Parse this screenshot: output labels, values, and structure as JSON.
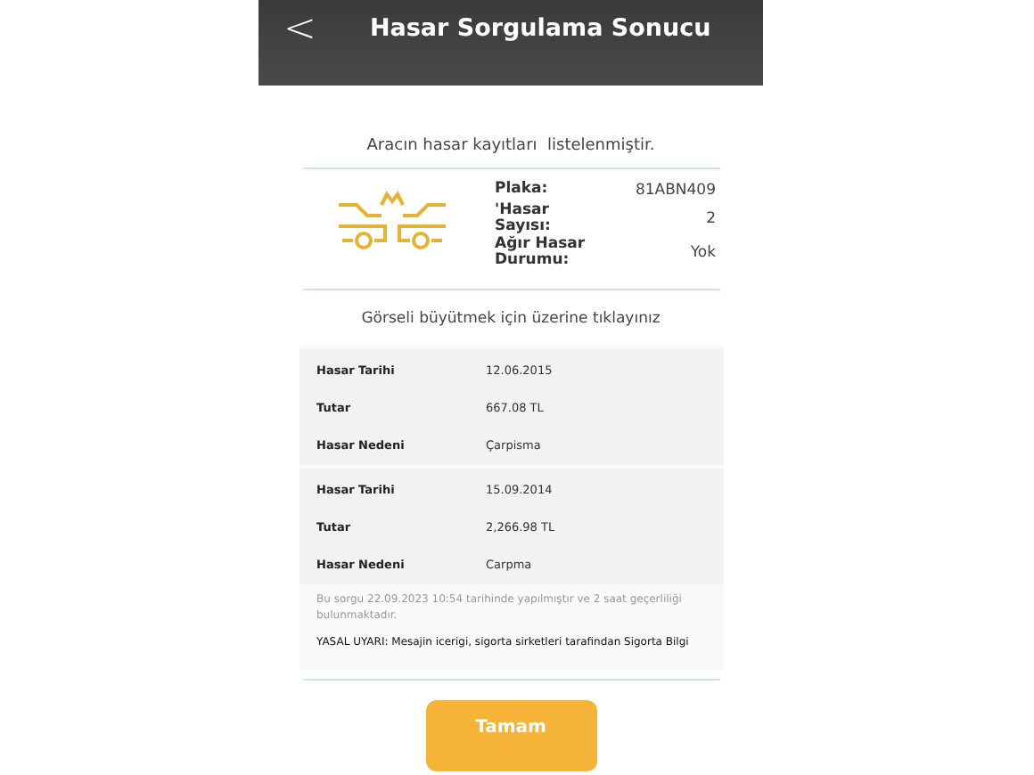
{
  "header": {
    "back": "<",
    "title": "Hasar Sorgulama Sonucu"
  },
  "message": "Aracın hasar kayıtları  listelenmiştir.",
  "summary": [
    {
      "label": "Plaka:",
      "value": "81ABN409"
    },
    {
      "label": "'Hasar Sayısı:",
      "value": "2"
    },
    {
      "label": "Ağır Hasar Durumu:",
      "value": "Yok"
    }
  ],
  "hint": "Görseli büyütmek için üzerine tıklayınız",
  "records": [
    [
      {
        "label": "Hasar Tarihi",
        "value": "12.06.2015"
      },
      {
        "label": "Tutar",
        "value": "667.08 TL"
      },
      {
        "label": "Hasar Nedeni",
        "value": "Çarpisma"
      }
    ],
    [
      {
        "label": "Hasar Tarihi",
        "value": "15.09.2014"
      },
      {
        "label": "Tutar",
        "value": "2,266.98 TL"
      },
      {
        "label": "Hasar Nedeni",
        "value": "Carpma"
      }
    ]
  ],
  "note": "Bu sorgu 22.09.2023 10:54 tarihinde yapılmıştır ve 2 saat geçerliliği bulunmaktadır.",
  "warning": "YASAL UYARI: Mesajin icerigi, sigorta sirketleri tarafindan Sigorta Bilgi",
  "button": "Tamam"
}
